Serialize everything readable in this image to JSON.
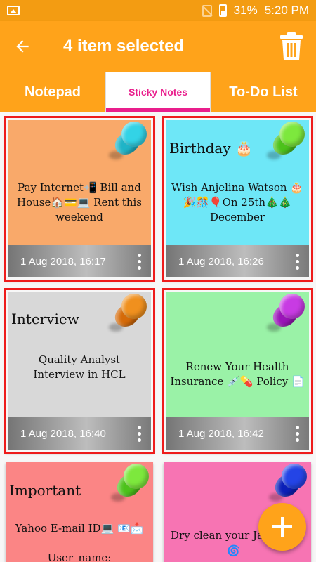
{
  "status_bar": {
    "battery": "31%",
    "time": "5:20 PM",
    "icons": [
      "gallery-icon",
      "no-sim-icon",
      "battery-icon"
    ]
  },
  "app_bar": {
    "title": "4 item selected",
    "back_icon": "arrow-back-icon",
    "delete_icon": "trash-icon"
  },
  "tabs": [
    {
      "label": "Notepad"
    },
    {
      "label": "Sticky Notes",
      "active": true
    },
    {
      "label": "To-Do List"
    }
  ],
  "colors": {
    "primary": "#ffa31a",
    "accent": "#e91e8c",
    "selected_border": "#ee1c1c"
  },
  "notes": [
    {
      "title": "",
      "body": "Pay Internet📲 Bill and House🏠💳💻 Rent this weekend",
      "date": "1 Aug 2018, 16:17",
      "color": "#f9a96a",
      "pin": "cyan",
      "selected": true
    },
    {
      "title": "Birthday 🎂",
      "body": "Wish Anjelina Watson 🎂🎉🎊🎈On 25th🎄🎄 December",
      "date": "1 Aug 2018, 16:26",
      "color": "#6ee7f7",
      "pin": "green",
      "selected": true
    },
    {
      "title": "Interview",
      "body": "Quality Analyst Interview in HCL",
      "date": "1 Aug 2018, 16:40",
      "color": "#d8d8d8",
      "pin": "orange",
      "selected": true
    },
    {
      "title": "",
      "body": "Renew Your Health Insurance 💉💊 Policy 📄",
      "date": "1 Aug 2018, 16:42",
      "color": "#9af2a7",
      "pin": "purple",
      "selected": true
    },
    {
      "title": "Important",
      "body": "Yahoo E-mail ID💻 📧📩",
      "body2": "User_name:",
      "date": "",
      "color": "#fb8585",
      "pin": "green",
      "selected": false
    },
    {
      "title": "",
      "body": "Dry clean your Ja",
      "body2": "🌀",
      "date": "",
      "color": "#f774b3",
      "pin": "blue",
      "selected": false
    }
  ],
  "fab": {
    "icon": "plus-icon"
  }
}
